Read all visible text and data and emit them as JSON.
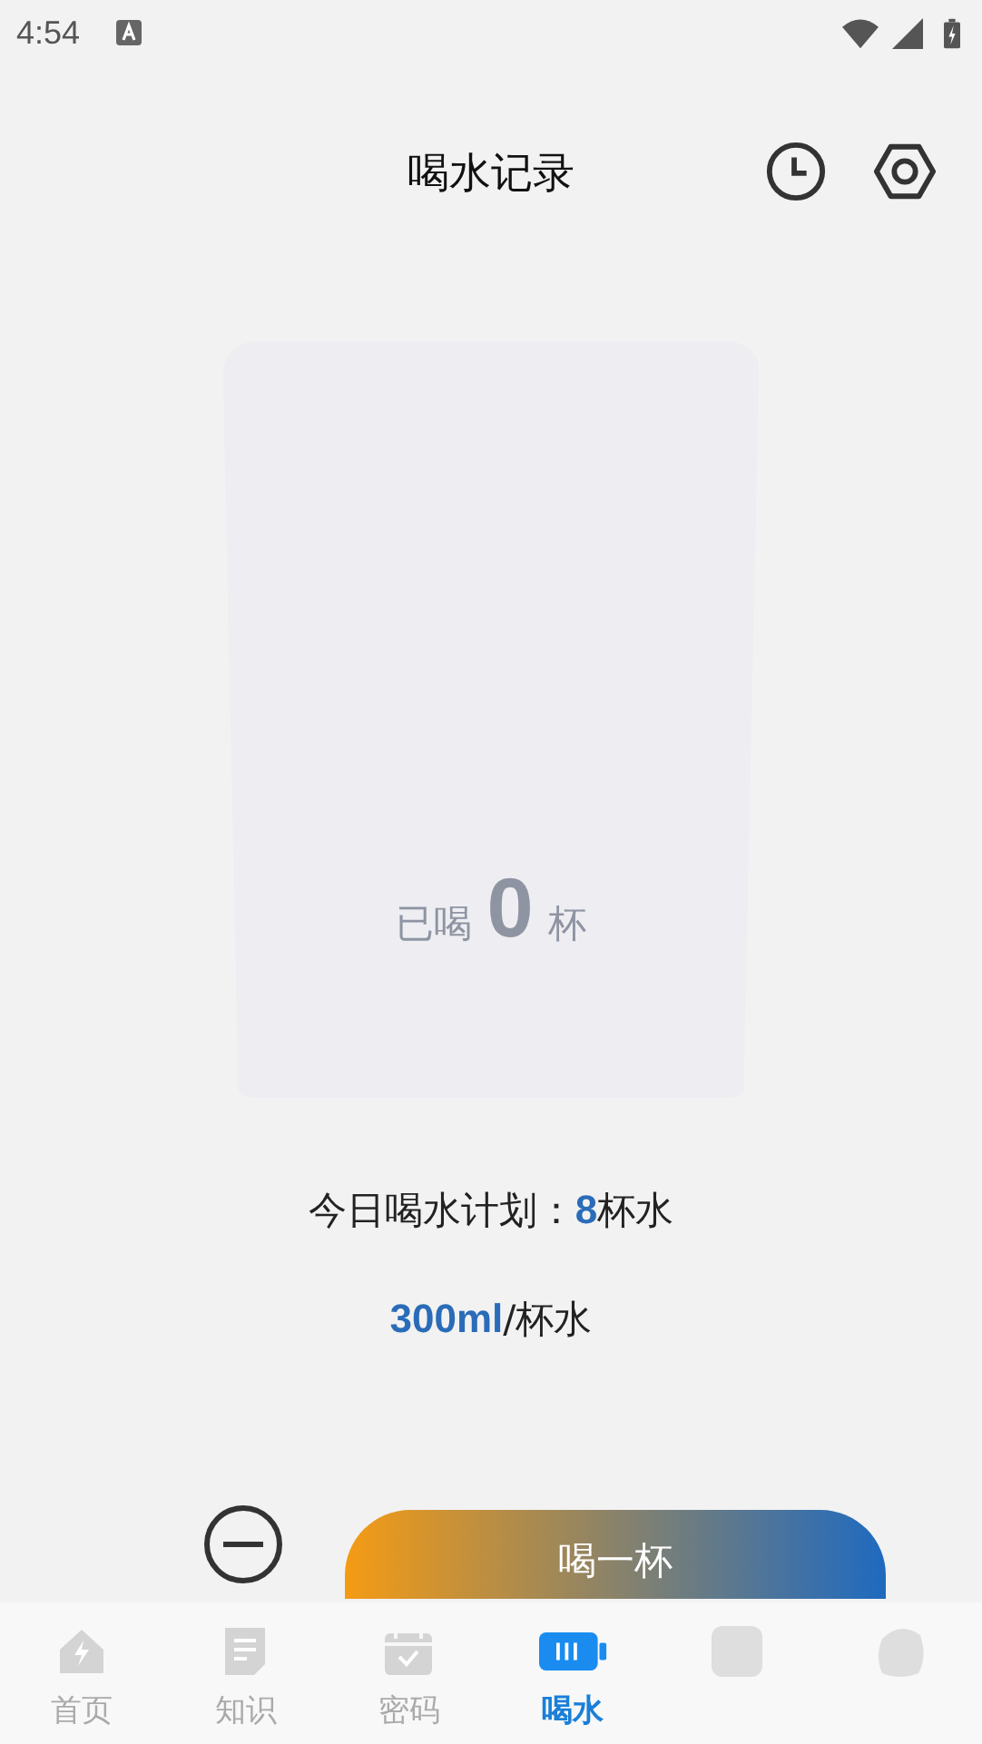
{
  "status_bar": {
    "time": "4:54"
  },
  "header": {
    "title": "喝水记录"
  },
  "cup": {
    "prefix": "已喝",
    "count": "0",
    "suffix": "杯"
  },
  "plan": {
    "label": "今日喝水计划：",
    "cups": "8",
    "unit": "杯水"
  },
  "volume": {
    "amount": "300ml",
    "unit": "/杯水"
  },
  "drink_button": {
    "label": "喝一杯"
  },
  "tabs": [
    {
      "label": "首页",
      "selected": false
    },
    {
      "label": "知识",
      "selected": false
    },
    {
      "label": "密码",
      "selected": false
    },
    {
      "label": "喝水",
      "selected": true
    },
    {
      "selected": false
    },
    {
      "selected": false
    }
  ]
}
